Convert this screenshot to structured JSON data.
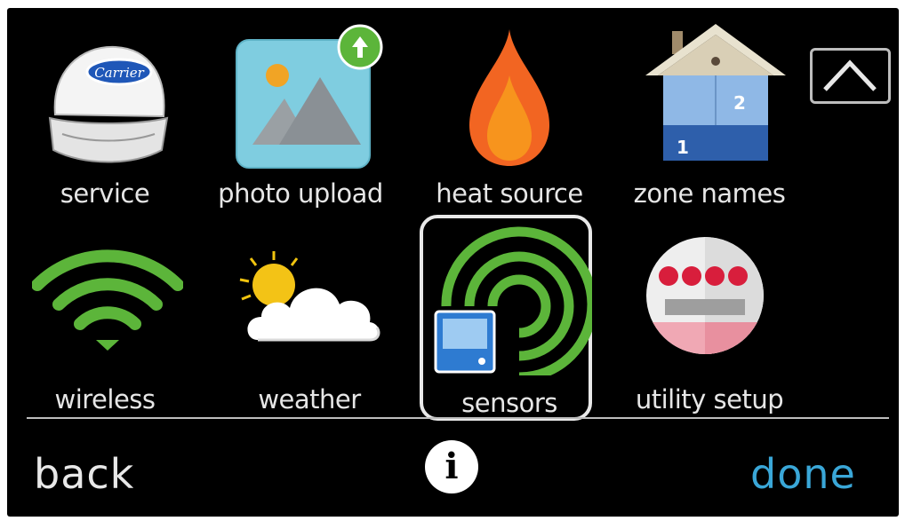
{
  "grid": {
    "items": [
      {
        "label": "service",
        "icon": "carrier-cap-icon"
      },
      {
        "label": "photo upload",
        "icon": "photo-upload-icon"
      },
      {
        "label": "heat source",
        "icon": "flame-icon"
      },
      {
        "label": "zone names",
        "icon": "house-zones-icon"
      },
      {
        "label": "wireless",
        "icon": "wifi-icon"
      },
      {
        "label": "weather",
        "icon": "sun-cloud-icon"
      },
      {
        "label": "sensors",
        "icon": "sensor-signal-icon",
        "selected": true
      },
      {
        "label": "utility setup",
        "icon": "utility-meter-icon"
      }
    ]
  },
  "cap_logo": "Carrier",
  "zone_numbers": [
    "1",
    "2"
  ],
  "footer": {
    "back_label": "back",
    "done_label": "done",
    "info_glyph": "i"
  },
  "colors": {
    "done": "#3aa7d8",
    "green": "#5cb53a",
    "background": "#000000"
  }
}
